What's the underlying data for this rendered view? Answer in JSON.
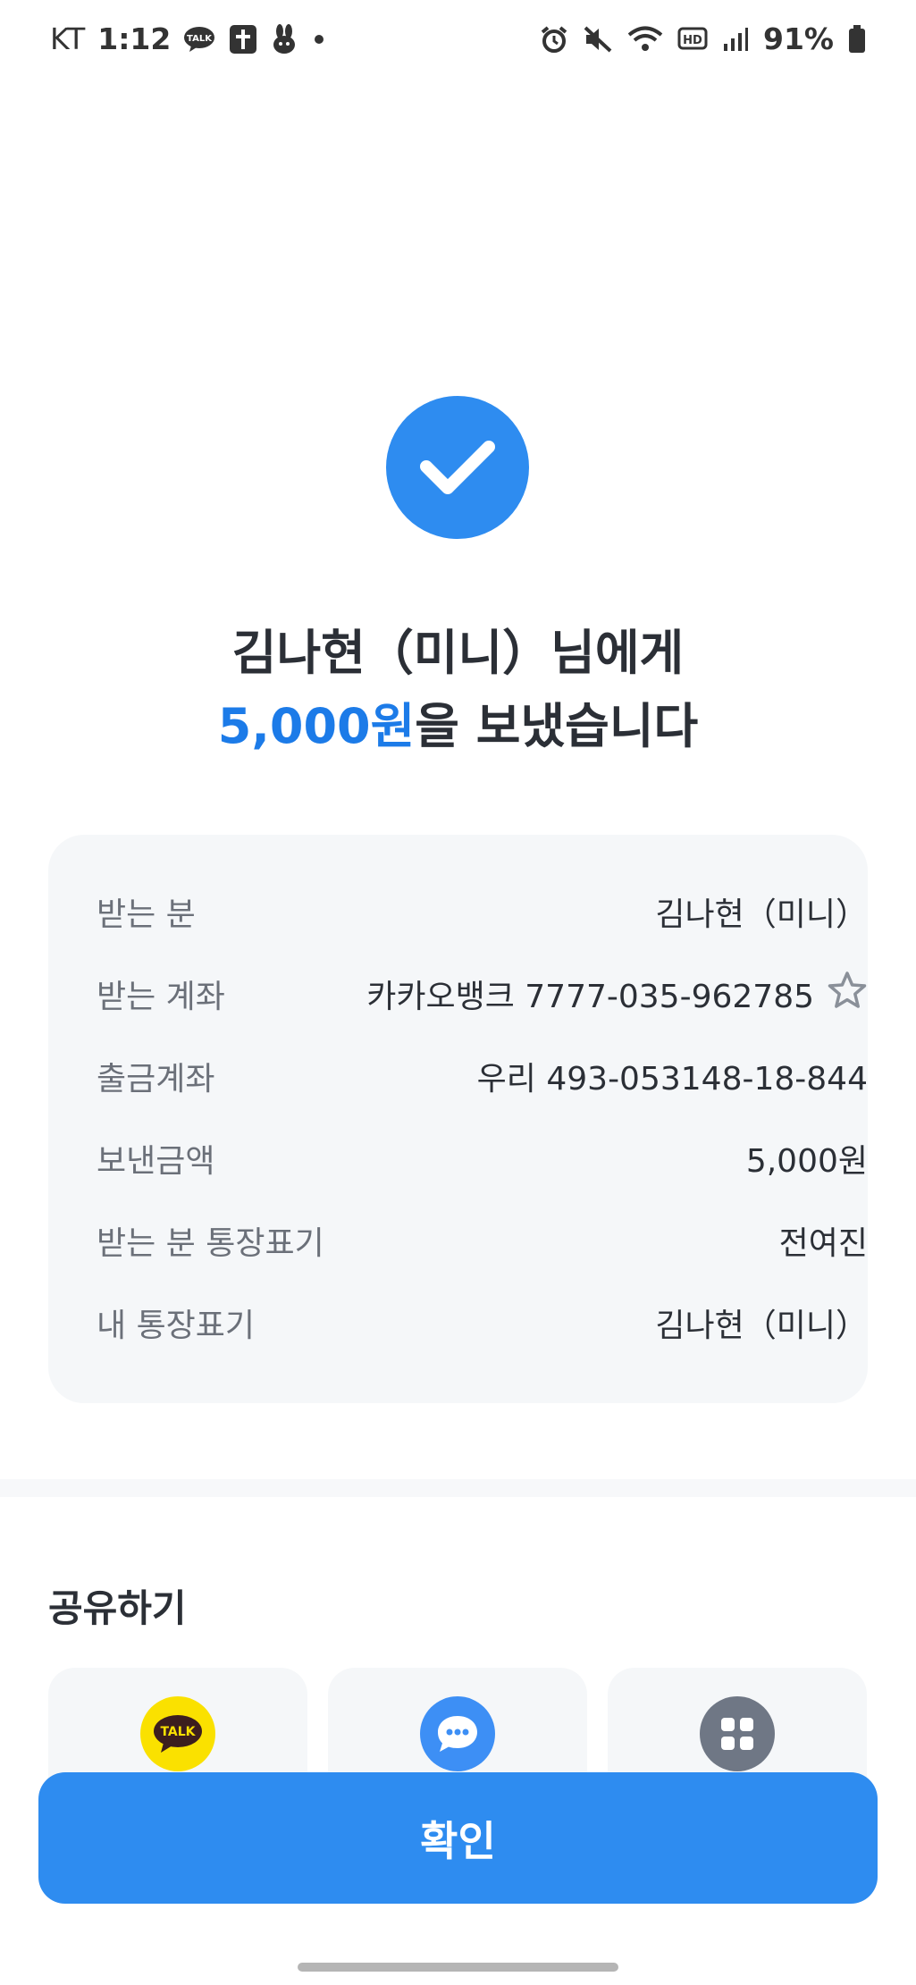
{
  "status_bar": {
    "carrier": "KT",
    "time": "1:12",
    "talk_badge": "TALK",
    "battery": "91%"
  },
  "result": {
    "recipient_line": "김나현（미니）님에게",
    "amount_highlight": "5,000원",
    "sent_suffix": "을 보냈습니다"
  },
  "details": [
    {
      "label": "받는 분",
      "value": "김나현（미니）"
    },
    {
      "label": "받는 계좌",
      "value": "카카오뱅크 7777-035-962785"
    },
    {
      "label": "출금계좌",
      "value": "우리 493-053148-18-844"
    },
    {
      "label": "보낸금액",
      "value": "5,000원"
    },
    {
      "label": "받는 분 통장표기",
      "value": "전여진"
    },
    {
      "label": "내 통장표기",
      "value": "김나현（미니）"
    }
  ],
  "share": {
    "title": "공유하기",
    "kakao_badge": "TALK",
    "icons": [
      "kakaotalk-icon",
      "message-icon",
      "more-apps-icon"
    ]
  },
  "confirm_label": "확인",
  "colors": {
    "accent": "#2e8cf0",
    "amount_text": "#1c7be8",
    "card_bg": "#f5f7f9",
    "kakao_yellow": "#fae100"
  }
}
